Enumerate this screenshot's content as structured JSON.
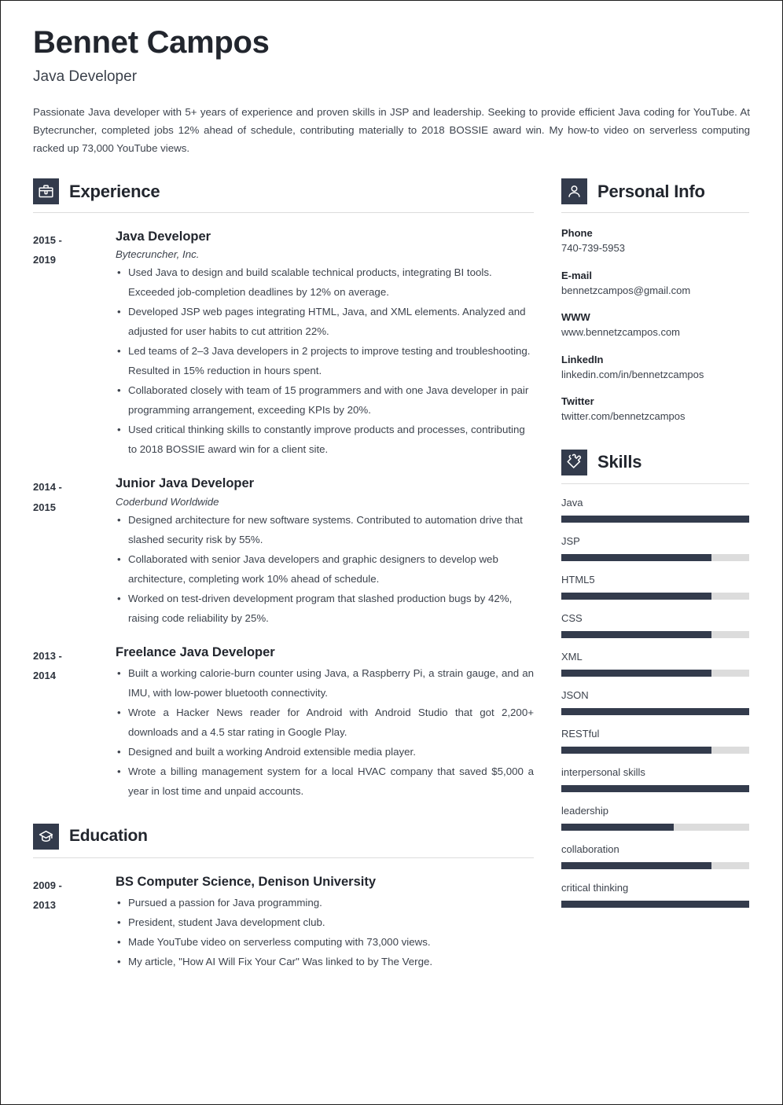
{
  "header": {
    "name": "Bennet Campos",
    "job_title": "Java Developer",
    "summary": "Passionate Java developer with 5+ years of experience and proven skills in JSP and leadership. Seeking to provide efficient Java coding for YouTube. At Bytecruncher, completed jobs 12% ahead of schedule, contributing materially to 2018 BOSSIE award win. My how-to video on serverless computing racked up 73,000 YouTube views."
  },
  "theme": {
    "accent": "#333b4c",
    "text": "#3d434d",
    "heading": "#22262e",
    "track": "#dcdcdc",
    "rule": "#dcdcdc"
  },
  "experience": {
    "icon": "briefcase-icon",
    "title": "Experience",
    "entries": [
      {
        "dates_from": "2015 -",
        "dates_to": "2019",
        "title": "Java Developer",
        "company": "Bytecruncher, Inc.",
        "justify": false,
        "bullets": [
          "Used Java to design and build scalable technical products, integrating BI tools. Exceeded job-completion deadlines by 12% on average.",
          "Developed JSP web pages integrating HTML, Java, and XML elements. Analyzed and adjusted for user habits to cut attrition 22%.",
          "Led teams of 2–3 Java developers in 2 projects to improve testing and troubleshooting. Resulted in 15% reduction in hours spent.",
          "Collaborated closely with team of 15 programmers and with one Java developer in pair programming arrangement, exceeding KPIs by 20%.",
          "Used critical thinking skills to constantly improve products and processes, contributing to 2018 BOSSIE award win for a client site."
        ]
      },
      {
        "dates_from": "2014 -",
        "dates_to": "2015",
        "title": "Junior Java Developer",
        "company": "Coderbund Worldwide",
        "justify": false,
        "bullets": [
          "Designed architecture for new software systems. Contributed to automation drive that slashed security risk by 55%.",
          "Collaborated with senior Java developers and graphic designers to develop web architecture, completing work 10% ahead of schedule.",
          "Worked on test-driven development program that slashed production bugs by 42%, raising code reliability by 25%."
        ]
      },
      {
        "dates_from": "2013 -",
        "dates_to": "2014",
        "title": "Freelance Java Developer",
        "company": "",
        "justify": true,
        "bullets": [
          "Built a working calorie-burn counter using Java, a Raspberry Pi, a strain gauge, and an IMU, with low-power bluetooth connectivity.",
          "Wrote a Hacker News reader for Android with Android Studio that got 2,200+ downloads and a 4.5 star rating in Google Play.",
          "Designed and built a working Android extensible media player.",
          "Wrote a billing management system for a local HVAC company that saved $5,000 a year in lost time and unpaid accounts."
        ]
      }
    ]
  },
  "education": {
    "icon": "graduation-cap-icon",
    "title": "Education",
    "entries": [
      {
        "dates_from": "2009 -",
        "dates_to": "2013",
        "title": "BS Computer Science, Denison University",
        "company": "",
        "justify": false,
        "bullets": [
          "Pursued a passion for Java programming.",
          "President, student Java development club.",
          "Made YouTube video on serverless computing with 73,000 views.",
          "My article, \"How AI Will Fix Your Car\" Was linked to by The Verge."
        ]
      }
    ]
  },
  "personal_info": {
    "icon": "person-icon",
    "title": "Personal Info",
    "fields": [
      {
        "label": "Phone",
        "value": "740-739-5953"
      },
      {
        "label": "E-mail",
        "value": "bennetzcampos@gmail.com"
      },
      {
        "label": "WWW",
        "value": "www.bennetzcampos.com"
      },
      {
        "label": "LinkedIn",
        "value": "linkedin.com/in/bennetzcampos"
      },
      {
        "label": "Twitter",
        "value": "twitter.com/bennetzcampos"
      }
    ]
  },
  "skills": {
    "icon": "puzzle-piece-icon",
    "title": "Skills",
    "items": [
      {
        "name": "Java",
        "level": 100
      },
      {
        "name": "JSP",
        "level": 80
      },
      {
        "name": "HTML5",
        "level": 80
      },
      {
        "name": "CSS",
        "level": 80
      },
      {
        "name": "XML",
        "level": 80
      },
      {
        "name": "JSON",
        "level": 100
      },
      {
        "name": "RESTful",
        "level": 80
      },
      {
        "name": "interpersonal skills",
        "level": 100
      },
      {
        "name": "leadership",
        "level": 60
      },
      {
        "name": "collaboration",
        "level": 80
      },
      {
        "name": "critical thinking",
        "level": 100
      }
    ]
  }
}
